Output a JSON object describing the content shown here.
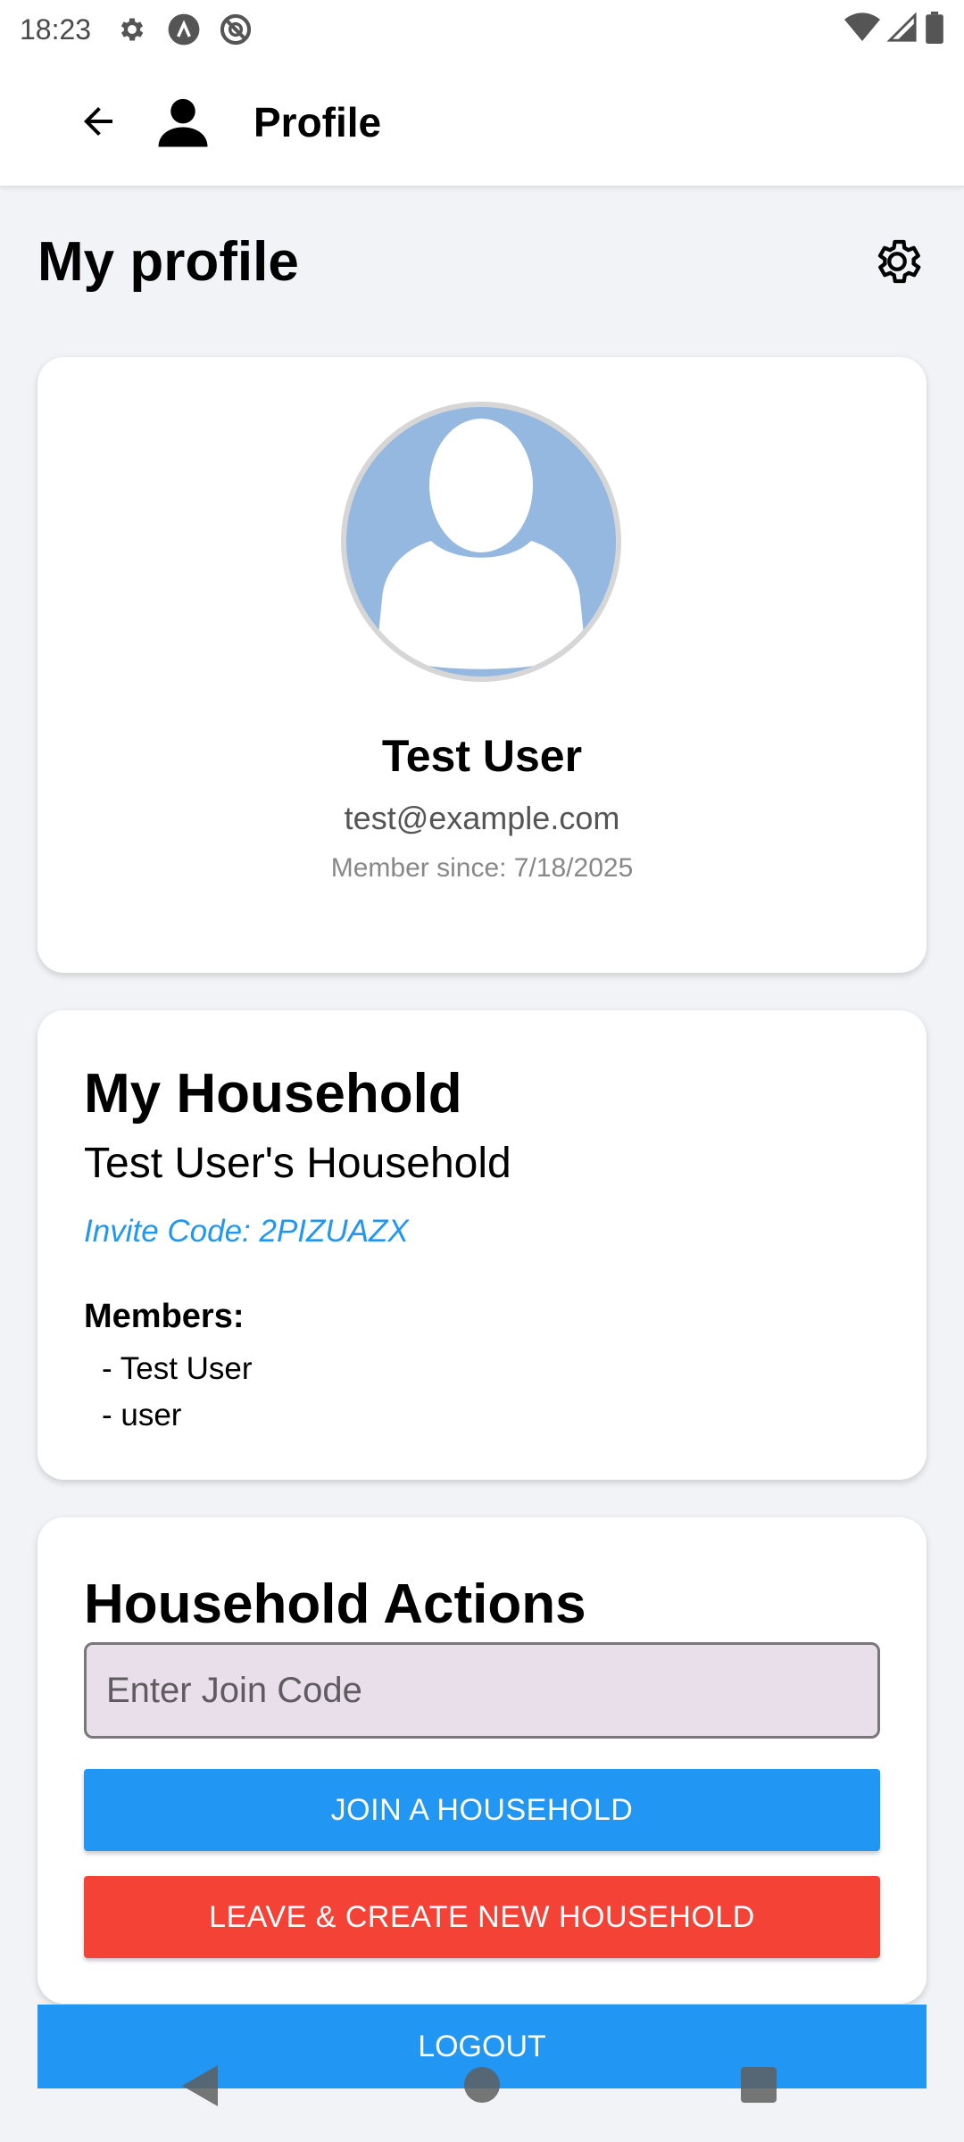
{
  "status_bar": {
    "time": "18:23"
  },
  "app_bar": {
    "title": "Profile"
  },
  "header": {
    "title": "My profile"
  },
  "profile_card": {
    "name": "Test User",
    "email": "test@example.com",
    "member_since": "Member since: 7/18/2025"
  },
  "household_card": {
    "title": "My Household",
    "household_name": "Test User's Household",
    "invite_code": "Invite Code: 2PIZUAZX",
    "members_label": "Members:",
    "members": [
      "- Test User",
      "- user"
    ]
  },
  "actions_card": {
    "title": "Household Actions",
    "join_code_placeholder": "Enter Join Code",
    "join_code_value": "",
    "join_button": "JOIN A HOUSEHOLD",
    "leave_button": "LEAVE & CREATE NEW HOUSEHOLD"
  },
  "logout_button": "LOGOUT",
  "colors": {
    "primary": "#2196f3",
    "danger": "#f44336",
    "avatar_bg": "#94b8df",
    "input_bg": "#e8dfea"
  },
  "icons": {
    "status": [
      "gear-icon",
      "lambda-icon",
      "no-sync-icon",
      "wifi-icon",
      "signal-icon",
      "battery-icon"
    ],
    "app_bar": [
      "back-arrow-icon",
      "person-icon"
    ],
    "header": [
      "settings-gear-icon"
    ],
    "nav": [
      "nav-back-icon",
      "nav-home-icon",
      "nav-recents-icon"
    ]
  }
}
